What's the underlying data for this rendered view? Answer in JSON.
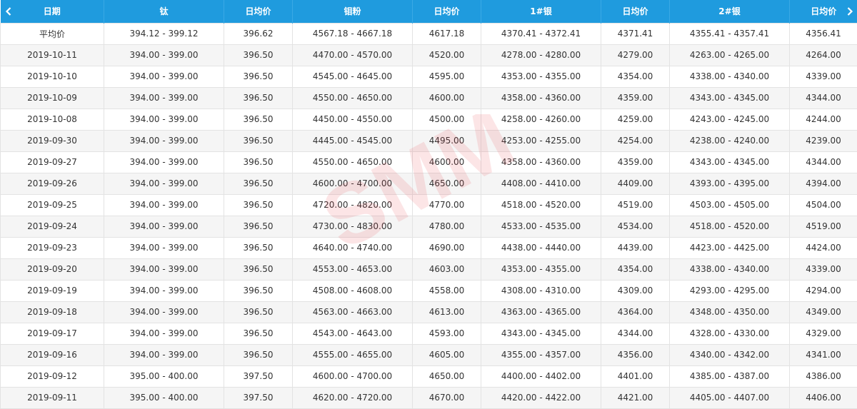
{
  "colors": {
    "header_bg": "#1f9bde",
    "header_text": "#ffffff",
    "stripe": "#f5f5f5",
    "watermark": "#e8323c"
  },
  "watermark_text": "SMM",
  "nav": {
    "prev_icon": "chevron-left-icon",
    "next_icon": "chevron-right-icon"
  },
  "columns": [
    "日期",
    "钛",
    "日均价",
    "钼粉",
    "日均价",
    "1#银",
    "日均价",
    "2#银",
    "日均价"
  ],
  "rows": [
    [
      "平均价",
      "394.12 - 399.12",
      "396.62",
      "4567.18 - 4667.18",
      "4617.18",
      "4370.41 - 4372.41",
      "4371.41",
      "4355.41 - 4357.41",
      "4356.41"
    ],
    [
      "2019-10-11",
      "394.00 - 399.00",
      "396.50",
      "4470.00 - 4570.00",
      "4520.00",
      "4278.00 - 4280.00",
      "4279.00",
      "4263.00 - 4265.00",
      "4264.00"
    ],
    [
      "2019-10-10",
      "394.00 - 399.00",
      "396.50",
      "4545.00 - 4645.00",
      "4595.00",
      "4353.00 - 4355.00",
      "4354.00",
      "4338.00 - 4340.00",
      "4339.00"
    ],
    [
      "2019-10-09",
      "394.00 - 399.00",
      "396.50",
      "4550.00 - 4650.00",
      "4600.00",
      "4358.00 - 4360.00",
      "4359.00",
      "4343.00 - 4345.00",
      "4344.00"
    ],
    [
      "2019-10-08",
      "394.00 - 399.00",
      "396.50",
      "4450.00 - 4550.00",
      "4500.00",
      "4258.00 - 4260.00",
      "4259.00",
      "4243.00 - 4245.00",
      "4244.00"
    ],
    [
      "2019-09-30",
      "394.00 - 399.00",
      "396.50",
      "4445.00 - 4545.00",
      "4495.00",
      "4253.00 - 4255.00",
      "4254.00",
      "4238.00 - 4240.00",
      "4239.00"
    ],
    [
      "2019-09-27",
      "394.00 - 399.00",
      "396.50",
      "4550.00 - 4650.00",
      "4600.00",
      "4358.00 - 4360.00",
      "4359.00",
      "4343.00 - 4345.00",
      "4344.00"
    ],
    [
      "2019-09-26",
      "394.00 - 399.00",
      "396.50",
      "4600.00 - 4700.00",
      "4650.00",
      "4408.00 - 4410.00",
      "4409.00",
      "4393.00 - 4395.00",
      "4394.00"
    ],
    [
      "2019-09-25",
      "394.00 - 399.00",
      "396.50",
      "4720.00 - 4820.00",
      "4770.00",
      "4518.00 - 4520.00",
      "4519.00",
      "4503.00 - 4505.00",
      "4504.00"
    ],
    [
      "2019-09-24",
      "394.00 - 399.00",
      "396.50",
      "4730.00 - 4830.00",
      "4780.00",
      "4533.00 - 4535.00",
      "4534.00",
      "4518.00 - 4520.00",
      "4519.00"
    ],
    [
      "2019-09-23",
      "394.00 - 399.00",
      "396.50",
      "4640.00 - 4740.00",
      "4690.00",
      "4438.00 - 4440.00",
      "4439.00",
      "4423.00 - 4425.00",
      "4424.00"
    ],
    [
      "2019-09-20",
      "394.00 - 399.00",
      "396.50",
      "4553.00 - 4653.00",
      "4603.00",
      "4353.00 - 4355.00",
      "4354.00",
      "4338.00 - 4340.00",
      "4339.00"
    ],
    [
      "2019-09-19",
      "394.00 - 399.00",
      "396.50",
      "4508.00 - 4608.00",
      "4558.00",
      "4308.00 - 4310.00",
      "4309.00",
      "4293.00 - 4295.00",
      "4294.00"
    ],
    [
      "2019-09-18",
      "394.00 - 399.00",
      "396.50",
      "4563.00 - 4663.00",
      "4613.00",
      "4363.00 - 4365.00",
      "4364.00",
      "4348.00 - 4350.00",
      "4349.00"
    ],
    [
      "2019-09-17",
      "394.00 - 399.00",
      "396.50",
      "4543.00 - 4643.00",
      "4593.00",
      "4343.00 - 4345.00",
      "4344.00",
      "4328.00 - 4330.00",
      "4329.00"
    ],
    [
      "2019-09-16",
      "394.00 - 399.00",
      "396.50",
      "4555.00 - 4655.00",
      "4605.00",
      "4355.00 - 4357.00",
      "4356.00",
      "4340.00 - 4342.00",
      "4341.00"
    ],
    [
      "2019-09-12",
      "395.00 - 400.00",
      "397.50",
      "4600.00 - 4700.00",
      "4650.00",
      "4400.00 - 4402.00",
      "4401.00",
      "4385.00 - 4387.00",
      "4386.00"
    ],
    [
      "2019-09-11",
      "395.00 - 400.00",
      "397.50",
      "4620.00 - 4720.00",
      "4670.00",
      "4420.00 - 4422.00",
      "4421.00",
      "4405.00 - 4407.00",
      "4406.00"
    ]
  ]
}
